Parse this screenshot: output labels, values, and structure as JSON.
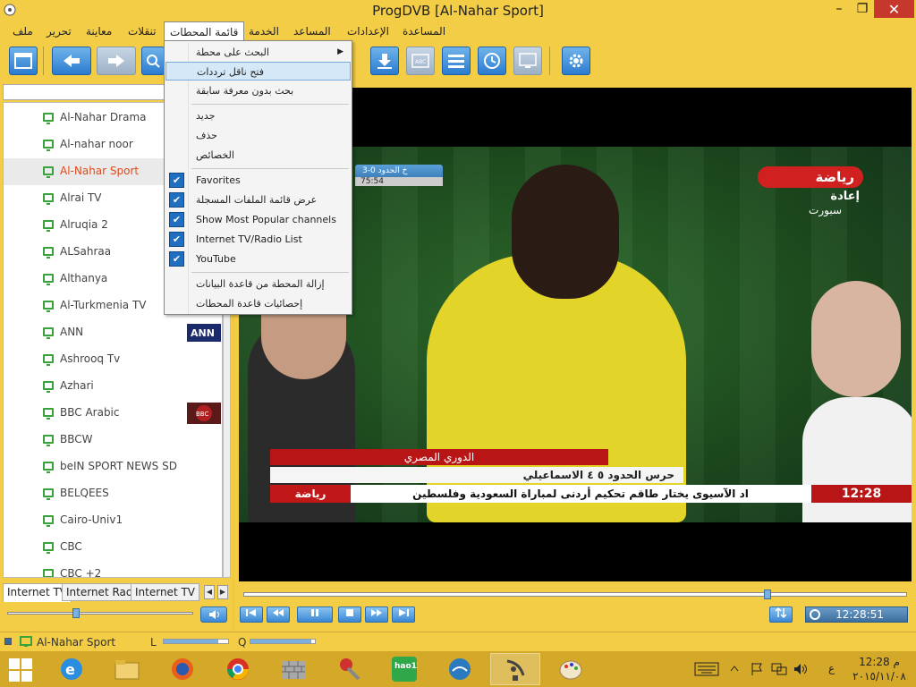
{
  "window": {
    "title": "ProgDVB [Al-Nahar Sport]",
    "min_glyph": "–",
    "max_glyph": "❐",
    "close_glyph": "✕"
  },
  "menu": {
    "items": [
      {
        "label": "ملف"
      },
      {
        "label": "تحرير"
      },
      {
        "label": "معاينة"
      },
      {
        "label": "تنقلات"
      },
      {
        "label": "قائمة المحطات"
      },
      {
        "label": "الخدمة"
      },
      {
        "label": "المساعد"
      },
      {
        "label": "الإعدادات"
      },
      {
        "label": "المساعدة"
      }
    ]
  },
  "dropdown": {
    "items": [
      {
        "label": "البحث على محطة",
        "has_submenu": true,
        "checked": false
      },
      {
        "label": "فتح ناقل ترددات",
        "checked": false,
        "hovered": true
      },
      {
        "label": "بحث بدون معرفة  سابقة",
        "checked": false
      },
      {
        "label": "جديد",
        "checked": false
      },
      {
        "label": "حذف",
        "checked": false
      },
      {
        "label": "الخصائص",
        "checked": false
      },
      {
        "label": "Favorites",
        "checked": true
      },
      {
        "label": "عرض قائمة الملفات المسجلة",
        "checked": true
      },
      {
        "label": "Show Most Popular channels",
        "checked": true
      },
      {
        "label": "Internet TV/Radio List",
        "checked": true
      },
      {
        "label": "YouTube",
        "checked": true
      },
      {
        "label": "إزالة المحطة من قاعدة البيانات",
        "checked": false
      },
      {
        "label": "إحصائيات قاعدة المحطات",
        "checked": false
      }
    ],
    "check_glyph": "✔",
    "submenu_glyph": "▶"
  },
  "channels": [
    {
      "name": "Al-Nahar Drama"
    },
    {
      "name": "Al-nahar noor"
    },
    {
      "name": "Al-Nahar Sport",
      "selected": true
    },
    {
      "name": "Alrai TV"
    },
    {
      "name": "Alruqia 2"
    },
    {
      "name": "ALSahraa"
    },
    {
      "name": "Althanya"
    },
    {
      "name": "Al-Turkmenia TV"
    },
    {
      "name": "ANN",
      "logo": "ANN"
    },
    {
      "name": "Ashrooq Tv"
    },
    {
      "name": "Azhari"
    },
    {
      "name": "BBC Arabic",
      "logo": "BBC"
    },
    {
      "name": "BBCW"
    },
    {
      "name": "beIN SPORT NEWS SD"
    },
    {
      "name": "BELQEES"
    },
    {
      "name": "Cairo-Univ1"
    },
    {
      "name": "CBC"
    },
    {
      "name": "CBC +2"
    }
  ],
  "tabs": [
    {
      "label": "Internet TV",
      "active": true
    },
    {
      "label": "Internet Radio"
    },
    {
      "label": "Internet TV"
    }
  ],
  "tab_nav": {
    "prev": "◀",
    "next": "▶"
  },
  "video": {
    "score_top": "خ الحدود  0-3",
    "score_time": "75:54",
    "channel_logo": "رياضة",
    "channel_sub1": "إعادة",
    "channel_sub2": "سبورت",
    "lower_third_title": "الدوري المصري",
    "lower_third_score": "حرس الحدود  ٥   ٤   الاسماعيلي",
    "ticker_text": "اد الآسيوى يختار طاقم تحكيم أردنى لمباراة السعودية وفلسطين",
    "ticker_logo": "رياضة",
    "ticker_time": "12:28"
  },
  "playback": {
    "progress_fraction": 0.79,
    "time": "12:28:51"
  },
  "status": {
    "channel": "Al-Nahar Sport",
    "level_label": "L",
    "quality_label": "Q",
    "level_fraction": 0.85,
    "quality_fraction": 0.95
  },
  "tray": {
    "lang": "ع",
    "time": "12:28 م",
    "date": "٢٠١٥/١١/٠٨",
    "hao_label": "hao123"
  }
}
